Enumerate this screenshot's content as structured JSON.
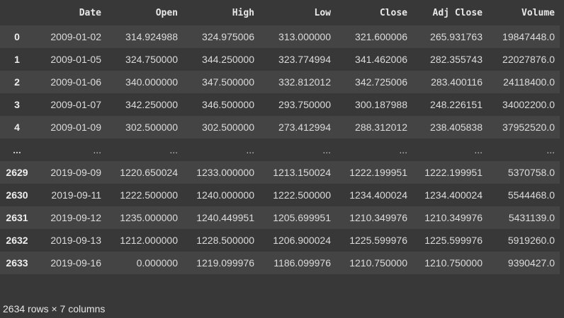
{
  "table": {
    "columns": [
      "",
      "Date",
      "Open",
      "High",
      "Low",
      "Close",
      "Adj Close",
      "Volume"
    ],
    "rows": [
      [
        "0",
        "2009-01-02",
        "314.924988",
        "324.975006",
        "313.000000",
        "321.600006",
        "265.931763",
        "19847448.0"
      ],
      [
        "1",
        "2009-01-05",
        "324.750000",
        "344.250000",
        "323.774994",
        "341.462006",
        "282.355743",
        "22027876.0"
      ],
      [
        "2",
        "2009-01-06",
        "340.000000",
        "347.500000",
        "332.812012",
        "342.725006",
        "283.400116",
        "24118400.0"
      ],
      [
        "3",
        "2009-01-07",
        "342.250000",
        "346.500000",
        "293.750000",
        "300.187988",
        "248.226151",
        "34002200.0"
      ],
      [
        "4",
        "2009-01-09",
        "302.500000",
        "302.500000",
        "273.412994",
        "288.312012",
        "238.405838",
        "37952520.0"
      ],
      [
        "...",
        "...",
        "...",
        "...",
        "...",
        "...",
        "...",
        "..."
      ],
      [
        "2629",
        "2019-09-09",
        "1220.650024",
        "1233.000000",
        "1213.150024",
        "1222.199951",
        "1222.199951",
        "5370758.0"
      ],
      [
        "2630",
        "2019-09-11",
        "1222.500000",
        "1240.000000",
        "1222.500000",
        "1234.400024",
        "1234.400024",
        "5544468.0"
      ],
      [
        "2631",
        "2019-09-12",
        "1235.000000",
        "1240.449951",
        "1205.699951",
        "1210.349976",
        "1210.349976",
        "5431139.0"
      ],
      [
        "2632",
        "2019-09-13",
        "1212.000000",
        "1228.500000",
        "1206.900024",
        "1225.599976",
        "1225.599976",
        "5919260.0"
      ],
      [
        "2633",
        "2019-09-16",
        "0.000000",
        "1219.099976",
        "1186.099976",
        "1210.750000",
        "1210.750000",
        "9390427.0"
      ]
    ]
  },
  "footer": {
    "shape_text": "2634 rows × 7 columns"
  },
  "colors": {
    "background": "#383838",
    "row_stripe": "#444444",
    "text": "#e6e6e6"
  }
}
